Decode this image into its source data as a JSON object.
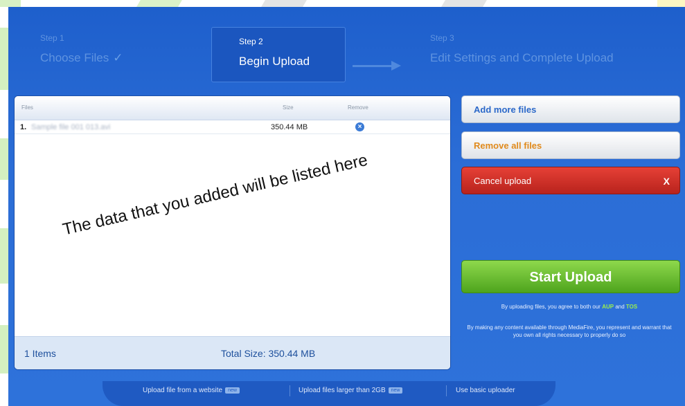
{
  "steps": {
    "step1": {
      "num": "Step 1",
      "title": "Choose Files"
    },
    "step2": {
      "num": "Step 2",
      "title": "Begin Upload"
    },
    "step3": {
      "num": "Step 3",
      "title": "Edit Settings and Complete Upload"
    }
  },
  "table": {
    "headers": {
      "file": "Files",
      "size": "Size",
      "remove": "Remove"
    },
    "rows": [
      {
        "index": "1.",
        "filename": "Sample file 001 013.avi",
        "size": "350.44 MB"
      }
    ],
    "annotation": "The data that you added will be listed here",
    "footer": {
      "items": "1 Items",
      "total": "Total Size:  350.44 MB"
    }
  },
  "actions": {
    "add_more": "Add more files",
    "remove_all": "Remove all files",
    "cancel": "Cancel upload",
    "cancel_x": "X",
    "start": "Start Upload"
  },
  "legal": {
    "line1_prefix": "By uploading files, you agree to both our",
    "aup": "AUP",
    "and": "and",
    "tos": "TOS",
    "line2": "By making any content available through MediaFire, you represent and warrant that you own all rights necessary to properly do so"
  },
  "bottom": {
    "item1": "Upload file from a website",
    "item2": "Upload files larger than 2GB",
    "item3": "Use basic uploader",
    "tag": "new"
  },
  "icons": {
    "check": "checkmark-icon",
    "remove": "remove-circle-icon"
  },
  "colors": {
    "frame": "#2f6ed4",
    "start": "#6cc236",
    "cancel": "#d5322a",
    "remove_all": "#e08a1c"
  }
}
